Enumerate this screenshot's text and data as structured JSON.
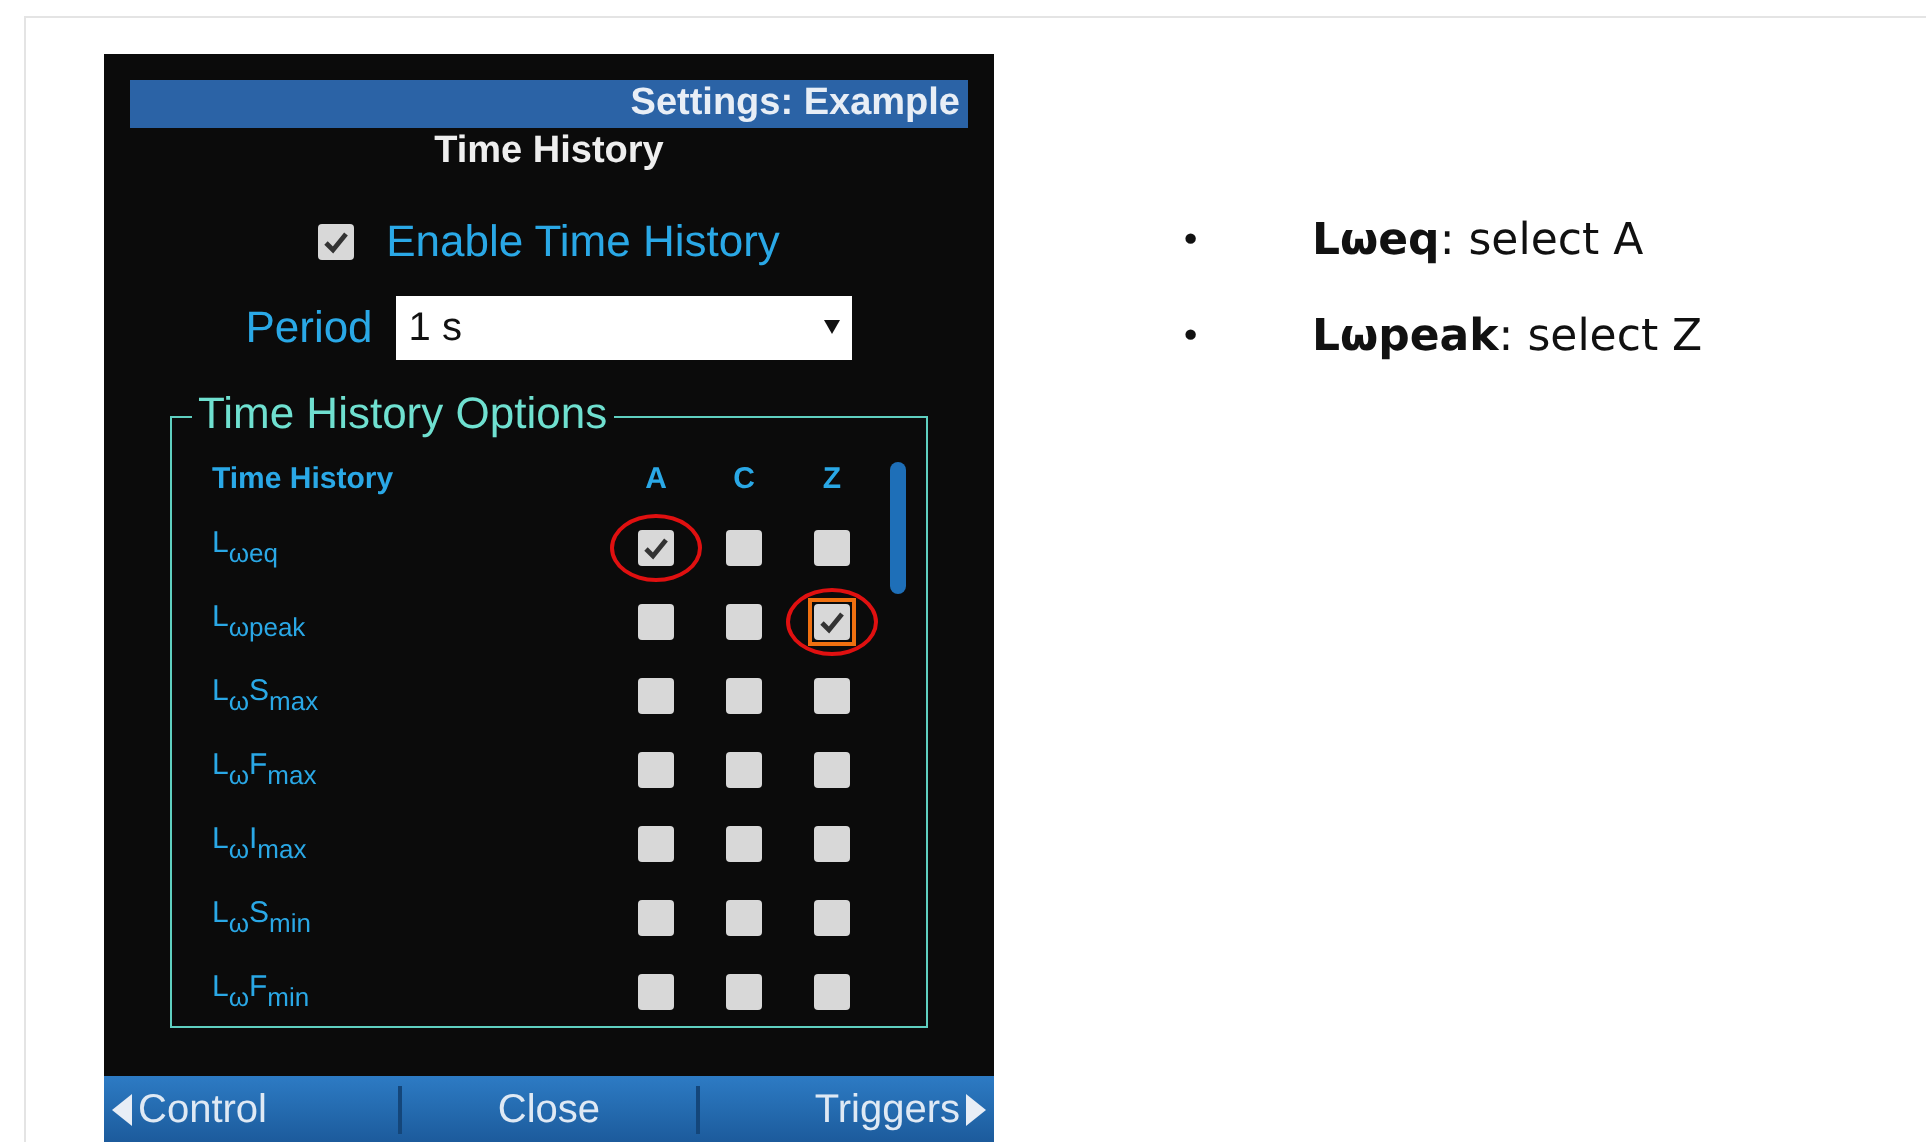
{
  "device": {
    "header": "Settings: Example",
    "title": "Time History",
    "enable": {
      "label": "Enable Time History",
      "checked": true
    },
    "period": {
      "label": "Period",
      "value": "1 s"
    },
    "options": {
      "legend": "Time History Options",
      "columns": [
        "Time History",
        "A",
        "C",
        "Z"
      ],
      "rows": [
        {
          "label": "L$_{ωeq}$",
          "cells": [
            {
              "checked": true,
              "circled": true,
              "focused": false
            },
            {
              "checked": false,
              "circled": false,
              "focused": false
            },
            {
              "checked": false,
              "circled": false,
              "focused": false
            }
          ]
        },
        {
          "label": "L$_{ωpeak}$",
          "cells": [
            {
              "checked": false,
              "circled": false,
              "focused": false
            },
            {
              "checked": false,
              "circled": false,
              "focused": false
            },
            {
              "checked": true,
              "circled": true,
              "focused": true
            }
          ]
        },
        {
          "label": "L$_{ω}$S$_{max}$",
          "cells": [
            {
              "checked": false,
              "circled": false,
              "focused": false
            },
            {
              "checked": false,
              "circled": false,
              "focused": false
            },
            {
              "checked": false,
              "circled": false,
              "focused": false
            }
          ]
        },
        {
          "label": "L$_{ω}$F$_{max}$",
          "cells": [
            {
              "checked": false,
              "circled": false,
              "focused": false
            },
            {
              "checked": false,
              "circled": false,
              "focused": false
            },
            {
              "checked": false,
              "circled": false,
              "focused": false
            }
          ]
        },
        {
          "label": "L$_{ω}$I$_{max}$",
          "cells": [
            {
              "checked": false,
              "circled": false,
              "focused": false
            },
            {
              "checked": false,
              "circled": false,
              "focused": false
            },
            {
              "checked": false,
              "circled": false,
              "focused": false
            }
          ]
        },
        {
          "label": "L$_{ω}$S$_{min}$",
          "cells": [
            {
              "checked": false,
              "circled": false,
              "focused": false
            },
            {
              "checked": false,
              "circled": false,
              "focused": false
            },
            {
              "checked": false,
              "circled": false,
              "focused": false
            }
          ]
        },
        {
          "label": "L$_{ω}$F$_{min}$",
          "cells": [
            {
              "checked": false,
              "circled": false,
              "focused": false
            },
            {
              "checked": false,
              "circled": false,
              "focused": false
            },
            {
              "checked": false,
              "circled": false,
              "focused": false
            }
          ]
        }
      ]
    },
    "footer": [
      "Control",
      "Close",
      "Triggers"
    ]
  },
  "notes": [
    {
      "bullet": "•",
      "text": "**Lωeq**: select A"
    },
    {
      "bullet": "•",
      "text": "**Lωpeak**: select Z"
    }
  ]
}
